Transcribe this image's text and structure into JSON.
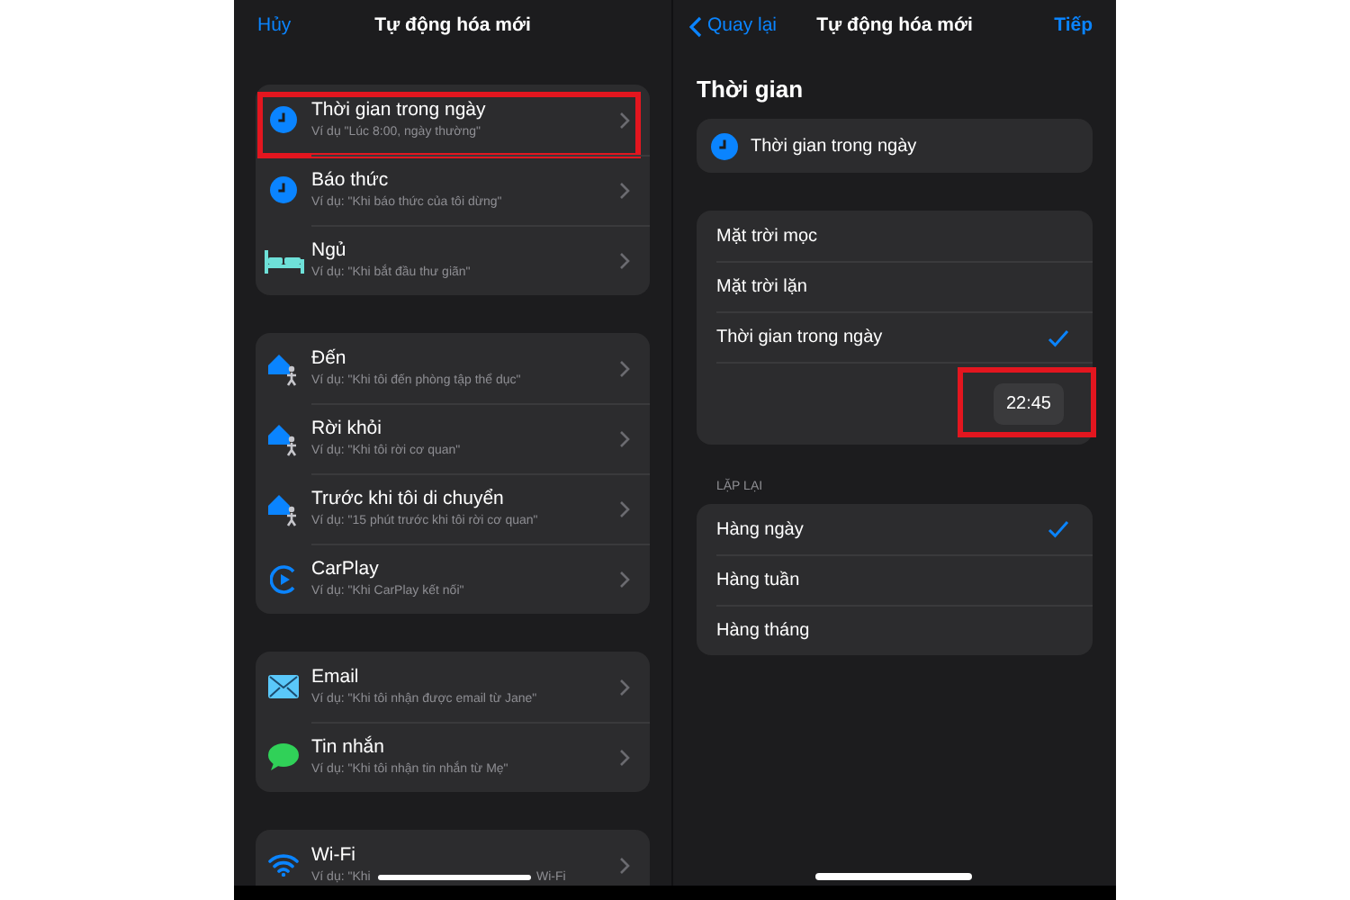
{
  "left_screen": {
    "nav": {
      "cancel": "Hủy",
      "title": "Tự động hóa mới"
    },
    "groups": [
      {
        "rows": [
          {
            "kind": "clock",
            "title": "Thời gian trong ngày",
            "subtitle": "Ví dụ \"Lúc 8:00, ngày thường\"",
            "highlighted": true
          },
          {
            "kind": "clock",
            "title": "Báo thức",
            "subtitle": "Ví dụ: \"Khi báo thức của tôi dừng\"",
            "highlighted": false
          },
          {
            "kind": "bed",
            "title": "Ngủ",
            "subtitle": "Ví dụ: \"Khi bắt đầu thư giãn\"",
            "highlighted": false
          }
        ]
      },
      {
        "rows": [
          {
            "kind": "home",
            "title": "Đến",
            "subtitle": "Ví dụ: \"Khi tôi đến phòng tập thể dục\"",
            "highlighted": false
          },
          {
            "kind": "home",
            "title": "Rời khỏi",
            "subtitle": "Ví dụ: \"Khi tôi rời cơ quan\"",
            "highlighted": false
          },
          {
            "kind": "home",
            "title": "Trước khi tôi di chuyển",
            "subtitle": "Ví dụ: \"15 phút trước khi tôi rời cơ quan\"",
            "highlighted": false
          },
          {
            "kind": "carplay",
            "title": "CarPlay",
            "subtitle": "Ví dụ: \"Khi CarPlay kết nối\"",
            "highlighted": false
          }
        ]
      },
      {
        "rows": [
          {
            "kind": "mail",
            "title": "Email",
            "subtitle": "Ví dụ: \"Khi tôi nhận được email từ Jane\"",
            "highlighted": false
          },
          {
            "kind": "message",
            "title": "Tin nhắn",
            "subtitle": "Ví dụ: \"Khi tôi nhận tin nhắn từ Mẹ\"",
            "highlighted": false
          }
        ]
      },
      {
        "rows": [
          {
            "kind": "wifi",
            "title": "Wi-Fi",
            "subtitle": "Ví dụ: \"Khi",
            "subtitle_end": "Wi-Fi",
            "highlighted": false
          }
        ]
      }
    ]
  },
  "right_screen": {
    "nav": {
      "back": "Quay lại",
      "title": "Tự động hóa mới",
      "next": "Tiếp"
    },
    "heading": "Thời gian",
    "trigger": {
      "kind": "clock",
      "title": "Thời gian trong ngày"
    },
    "options": [
      {
        "label": "Mặt trời mọc",
        "selected": false
      },
      {
        "label": "Mặt trời lặn",
        "selected": false
      },
      {
        "label": "Thời gian trong ngày",
        "selected": true
      }
    ],
    "time": {
      "value": "22:45",
      "highlighted": true
    },
    "repeat_header": "LẶP LẠI",
    "repeat_options": [
      {
        "label": "Hàng ngày",
        "selected": true
      },
      {
        "label": "Hàng tuần",
        "selected": false
      },
      {
        "label": "Hàng tháng",
        "selected": false
      }
    ]
  }
}
